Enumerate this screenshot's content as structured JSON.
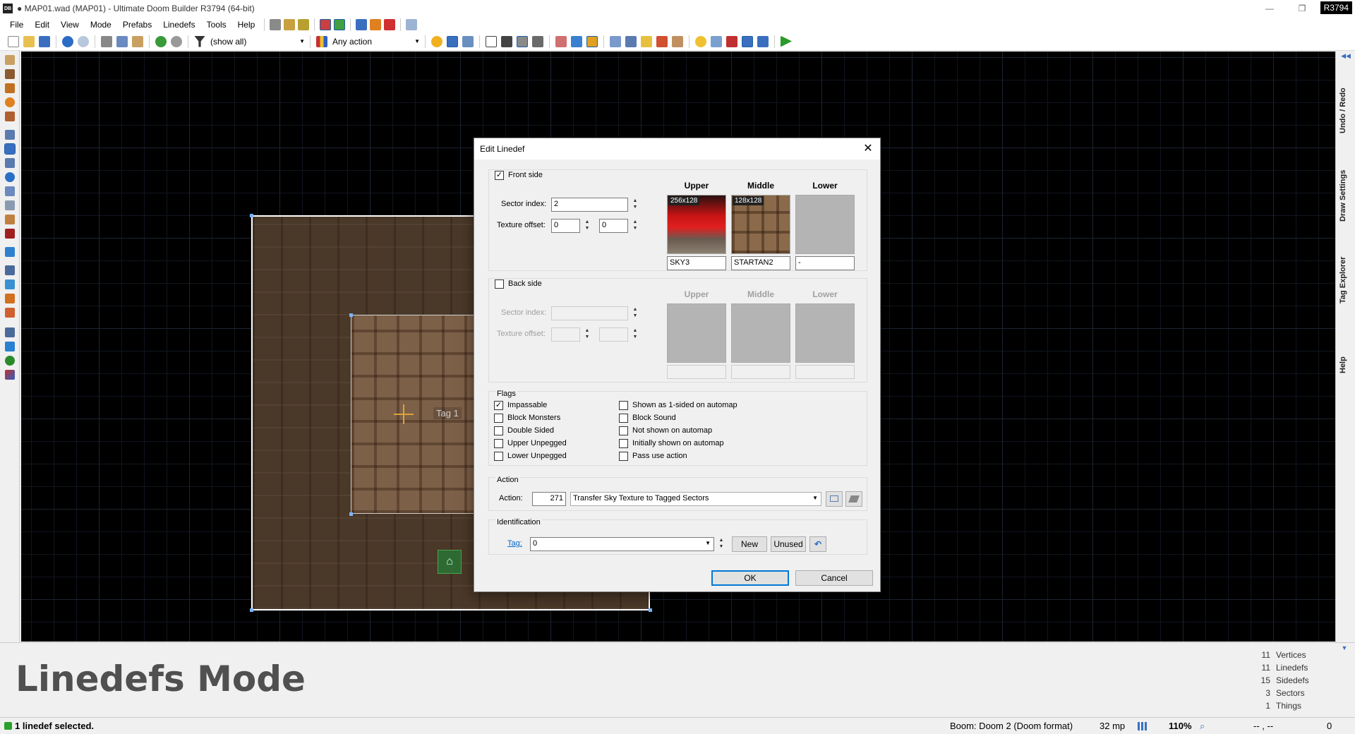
{
  "window": {
    "title": "● MAP01.wad (MAP01) - Ultimate Doom Builder R3794 (64-bit)",
    "app_badge": "DB",
    "revision": "R3794",
    "minimize": "—",
    "maximize": "❐",
    "close": "✕"
  },
  "menu": [
    "File",
    "Edit",
    "View",
    "Mode",
    "Prefabs",
    "Linedefs",
    "Tools",
    "Help"
  ],
  "toolbar": {
    "filter_value": "(show all)",
    "action_value": "Any action"
  },
  "canvas": {
    "tag_label": "Tag 1"
  },
  "right_dock": {
    "collapse": "◀◀",
    "tabs": [
      "Undo / Redo",
      "Draw Settings",
      "Tag Explorer",
      "Help"
    ],
    "bottom_toggle": "▼"
  },
  "mode_title": "Linedefs Mode",
  "stats": [
    {
      "count": "11",
      "label": "Vertices"
    },
    {
      "count": "11",
      "label": "Linedefs"
    },
    {
      "count": "15",
      "label": "Sidedefs"
    },
    {
      "count": "3",
      "label": "Sectors"
    },
    {
      "count": "1",
      "label": "Things"
    }
  ],
  "status": {
    "message": "1 linedef selected.",
    "game_config": "Boom: Doom 2 (Doom format)",
    "grid": "32 mp",
    "zoom": "110%",
    "coords": "-- , --",
    "counter": "0"
  },
  "dialog": {
    "title": "Edit Linedef",
    "close": "✕",
    "front": {
      "label": "Front side",
      "checked": true,
      "sector_index_label": "Sector index:",
      "sector_index": "2",
      "texture_offset_label": "Texture offset:",
      "offset_x": "0",
      "offset_y": "0",
      "upper_header": "Upper",
      "middle_header": "Middle",
      "lower_header": "Lower",
      "upper_size": "256x128",
      "middle_size": "128x128",
      "upper_tex": "SKY3",
      "middle_tex": "STARTAN2",
      "lower_tex": "-"
    },
    "back": {
      "label": "Back side",
      "checked": false,
      "sector_index_label": "Sector index:",
      "texture_offset_label": "Texture offset:",
      "upper_header": "Upper",
      "middle_header": "Middle",
      "lower_header": "Lower"
    },
    "flags": {
      "title": "Flags",
      "left": [
        {
          "label": "Impassable",
          "checked": true
        },
        {
          "label": "Block Monsters",
          "checked": false
        },
        {
          "label": "Double Sided",
          "checked": false
        },
        {
          "label": "Upper Unpegged",
          "checked": false
        },
        {
          "label": "Lower Unpegged",
          "checked": false
        }
      ],
      "right": [
        {
          "label": "Shown as 1-sided on automap",
          "checked": false
        },
        {
          "label": "Block Sound",
          "checked": false
        },
        {
          "label": "Not shown on automap",
          "checked": false
        },
        {
          "label": "Initially shown on automap",
          "checked": false
        },
        {
          "label": "Pass use action",
          "checked": false
        }
      ]
    },
    "action": {
      "title": "Action",
      "label": "Action:",
      "number": "271",
      "name": "Transfer Sky Texture to Tagged Sectors"
    },
    "identification": {
      "title": "Identification",
      "tag_label": "Tag:",
      "tag_value": "0",
      "new_label": "New",
      "unused_label": "Unused"
    },
    "ok_label": "OK",
    "cancel_label": "Cancel"
  },
  "colors": {
    "accent": "#0078d7",
    "status_led": "#2aa12a",
    "sky_red": "#c81414"
  }
}
